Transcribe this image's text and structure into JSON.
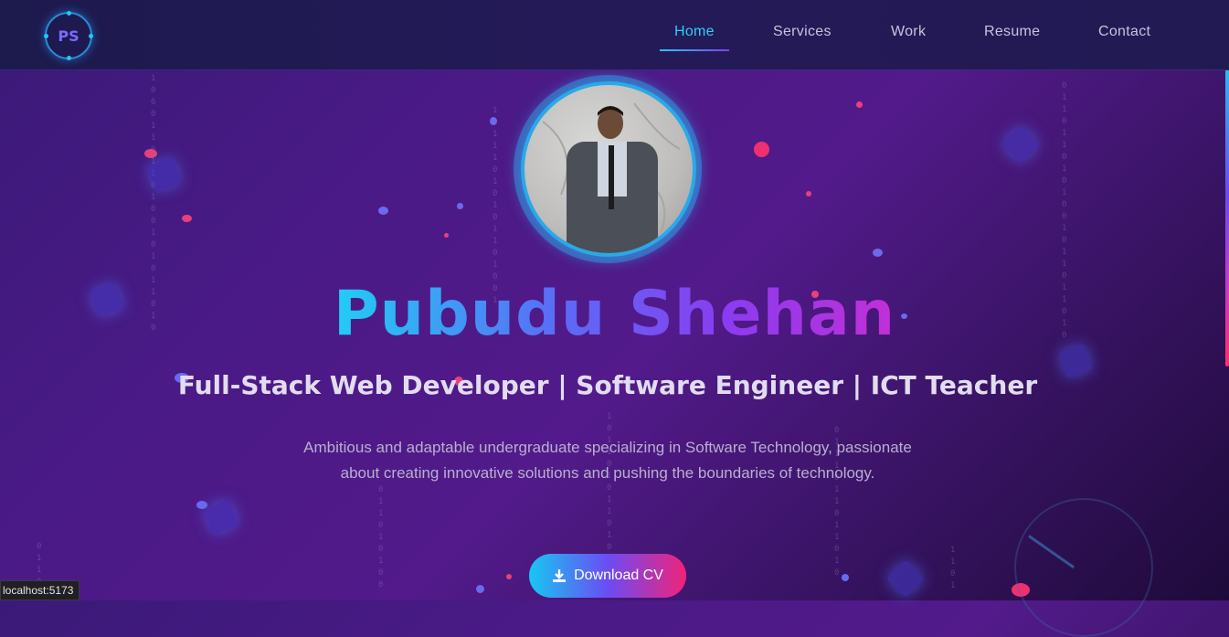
{
  "logo": {
    "text": "PS"
  },
  "nav": {
    "items": [
      {
        "label": "Home",
        "active": true
      },
      {
        "label": "Services",
        "active": false
      },
      {
        "label": "Work",
        "active": false
      },
      {
        "label": "Resume",
        "active": false
      },
      {
        "label": "Contact",
        "active": false
      }
    ]
  },
  "hero": {
    "name": "Pubudu Shehan",
    "subtitle": "Full-Stack Web Developer | Software Engineer | ICT Teacher",
    "description": "Ambitious and adaptable undergraduate specializing in Software Technology, passionate about creating innovative solutions and pushing the boundaries of technology.",
    "cv_button": "Download CV"
  },
  "status_bar": {
    "url": "localhost:5173"
  },
  "colors": {
    "accent_cyan": "#29d2f5",
    "accent_purple": "#7b3ff2",
    "accent_pink": "#f0237a"
  }
}
